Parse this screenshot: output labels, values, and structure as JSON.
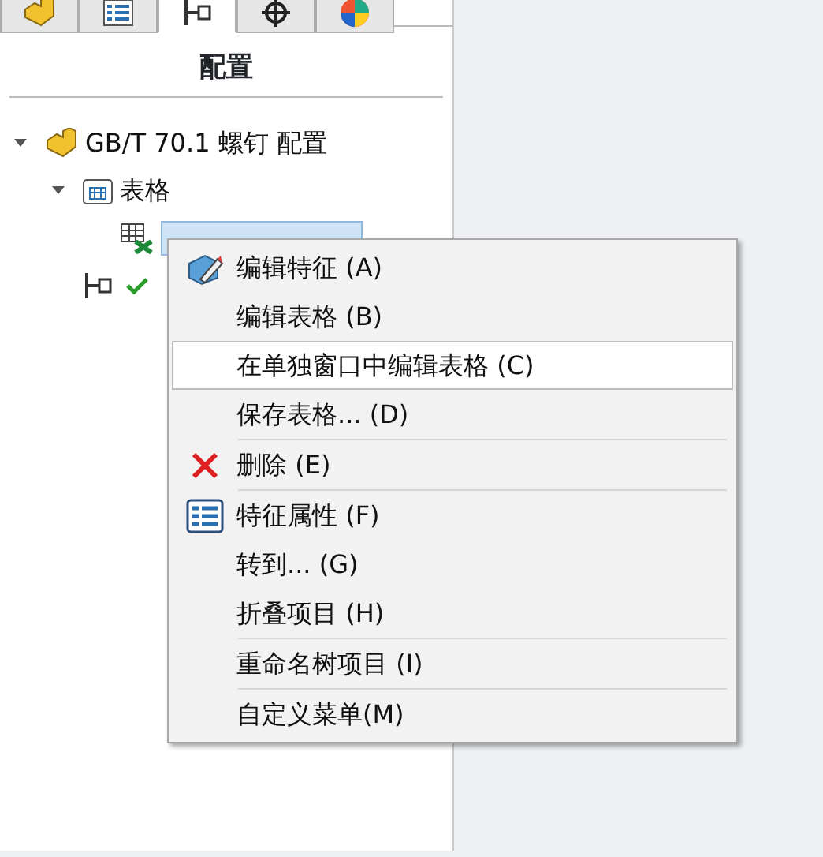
{
  "tabs": [
    {
      "kind": "part",
      "selected": false
    },
    {
      "kind": "list",
      "selected": false
    },
    {
      "kind": "config",
      "selected": true
    },
    {
      "kind": "target",
      "selected": false
    },
    {
      "kind": "appearance",
      "selected": false
    }
  ],
  "panel_title": "配置",
  "tree": [
    {
      "kind": "part",
      "label": "GB/T 70.1 螺钉 配置",
      "expanded": true,
      "selected": false,
      "children": [
        {
          "kind": "folder",
          "label": "表格",
          "expanded": true,
          "selected": false,
          "children": [
            {
              "kind": "table",
              "selected": true
            }
          ]
        },
        {
          "kind": "config"
        }
      ]
    }
  ],
  "context_menu": [
    {
      "kind": "edit",
      "label": "编辑特征 (A)",
      "hovered": false
    },
    {
      "kind": "plain",
      "label": "编辑表格 (B)",
      "hovered": false
    },
    {
      "kind": "plain",
      "label": "在单独窗口中编辑表格 (C)",
      "hovered": true
    },
    {
      "kind": "plain",
      "label": "保存表格... (D)",
      "hovered": false
    },
    {
      "kind": "separator"
    },
    {
      "kind": "delete",
      "label": "删除 (E)",
      "hovered": false
    },
    {
      "kind": "separator"
    },
    {
      "kind": "properties",
      "label": "特征属性 (F)",
      "hovered": false
    },
    {
      "kind": "plain",
      "label": "转到... (G)",
      "hovered": false
    },
    {
      "kind": "plain",
      "label": "折叠项目 (H)",
      "hovered": false
    },
    {
      "kind": "separator"
    },
    {
      "kind": "plain",
      "label": "重命名树项目 (I)",
      "hovered": false
    },
    {
      "kind": "separator"
    },
    {
      "kind": "plain",
      "label": "自定义菜单(M)",
      "hovered": false
    }
  ]
}
